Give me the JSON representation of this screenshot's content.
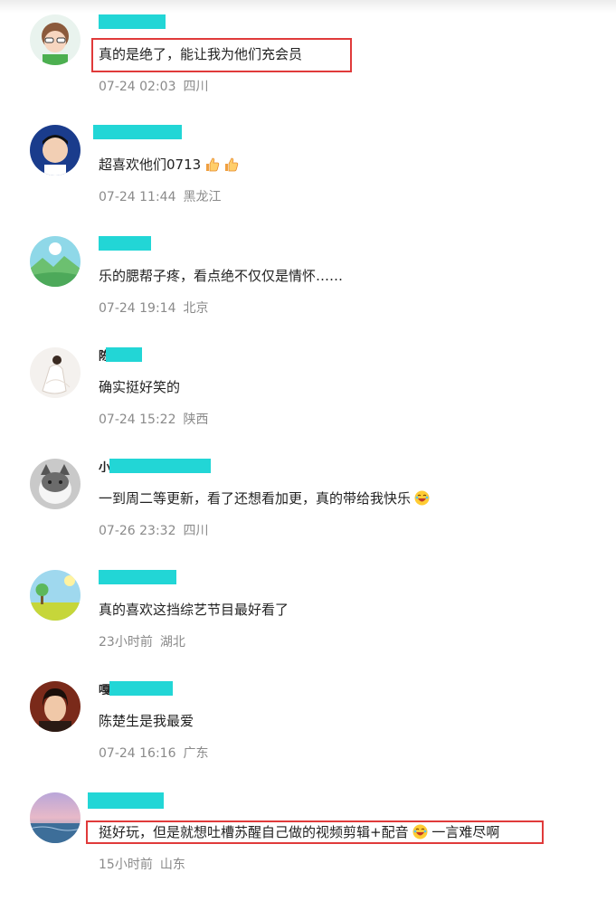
{
  "comments": [
    {
      "name_visible": "",
      "text": "真的是绝了，能让我为他们充会员",
      "time": "07-24 02:03",
      "location": "四川",
      "highlight": true
    },
    {
      "name_visible": "",
      "text": "超喜欢他们0713",
      "time": "07-24 11:44",
      "location": "黑龙江",
      "emoji": "thumbs-up-icon"
    },
    {
      "name_visible": "",
      "text": "乐的腮帮子疼，看点绝不仅仅是情怀……",
      "time": "07-24 19:14",
      "location": "北京"
    },
    {
      "name_visible": "陈",
      "text": "确实挺好笑的",
      "time": "07-24 15:22",
      "location": "陕西"
    },
    {
      "name_visible": "小",
      "text": "一到周二等更新，看了还想看加更，真的带给我快乐",
      "time": "07-26 23:32",
      "location": "四川",
      "emoji": "laughing-face-icon"
    },
    {
      "name_visible": "",
      "text": "真的喜欢这挡综艺节目最好看了",
      "time": "23小时前",
      "location": "湖北"
    },
    {
      "name_visible": "嘎",
      "text": "陈楚生是我最爱",
      "time": "07-24 16:16",
      "location": "广东"
    },
    {
      "name_visible": "",
      "text": "挺好玩，但是就想吐槽苏醒自己做的视频剪辑+配音",
      "text_after_emoji": "一言难尽啊",
      "time": "15小时前",
      "location": "山东",
      "highlight": true,
      "emoji": "laughing-face-icon"
    }
  ],
  "colors": {
    "highlight_border": "#e03a3a",
    "name_mask": "#22d6d6",
    "meta_text": "#8a8a8a"
  }
}
